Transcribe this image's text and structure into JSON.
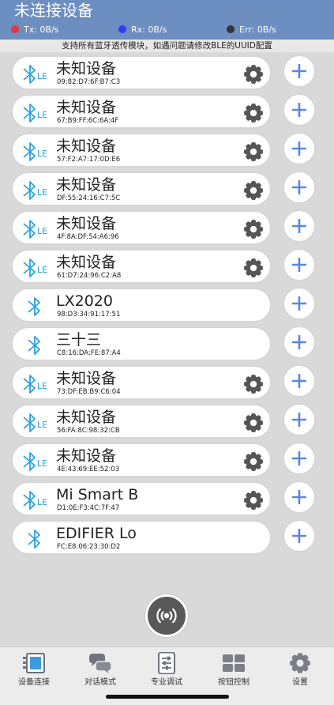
{
  "header": {
    "title": "未连接设备",
    "tx": "Tx: 0B/s",
    "rx": "Rx: 0B/s",
    "err": "Err: 0B/s",
    "colors": {
      "tx": "#e8343f",
      "rx": "#2f3bff",
      "err": "#333333"
    }
  },
  "hint": "支持所有蓝牙透传模块，如遇问题请修改BLE的UUID配置",
  "devices": [
    {
      "name": "未知设备",
      "mac": "09:82:D7:6F:B7:C3",
      "ble": true,
      "settings": true
    },
    {
      "name": "未知设备",
      "mac": "67:B9:FF:6C:6A:4F",
      "ble": true,
      "settings": true
    },
    {
      "name": "未知设备",
      "mac": "57:F2:A7:17:0D:E6",
      "ble": true,
      "settings": true
    },
    {
      "name": "未知设备",
      "mac": "DF:55:24:16:C7:5C",
      "ble": true,
      "settings": true
    },
    {
      "name": "未知设备",
      "mac": "4F:8A:DF:54:A6:96",
      "ble": true,
      "settings": true
    },
    {
      "name": "未知设备",
      "mac": "61:D7:24:96:C2:A8",
      "ble": true,
      "settings": true
    },
    {
      "name": "LX2020",
      "mac": "98:D3:34:91:17:51",
      "ble": false,
      "settings": false
    },
    {
      "name": "三十三",
      "mac": "C8:16:DA:FE:87:A4",
      "ble": false,
      "settings": false
    },
    {
      "name": "未知设备",
      "mac": "73:DF:EB:B9:C6:04",
      "ble": true,
      "settings": true
    },
    {
      "name": "未知设备",
      "mac": "56:FA:8C:98:32:CB",
      "ble": true,
      "settings": true
    },
    {
      "name": "未知设备",
      "mac": "4E:43:69:EE:52:03",
      "ble": true,
      "settings": true
    },
    {
      "name": "Mi Smart B",
      "mac": "D1:0E:F3:4C:7F:47",
      "ble": true,
      "settings": true
    },
    {
      "name": "EDIFIER Lo",
      "mac": "FC:E8:06:23:30:D2",
      "ble": false,
      "settings": false
    }
  ],
  "tabs": [
    {
      "label": "设备连接",
      "icon": "device-connect-icon"
    },
    {
      "label": "对话模式",
      "icon": "chat-bubbles-icon"
    },
    {
      "label": "专业调试",
      "icon": "sliders-icon"
    },
    {
      "label": "按钮控制",
      "icon": "button-grid-icon"
    },
    {
      "label": "设置",
      "icon": "gear-icon"
    }
  ],
  "colors": {
    "header": "#6c8ec0",
    "bt": "#29a3e0",
    "plus": "#5b86e0",
    "gear": "#555555",
    "fab": "#595959"
  }
}
